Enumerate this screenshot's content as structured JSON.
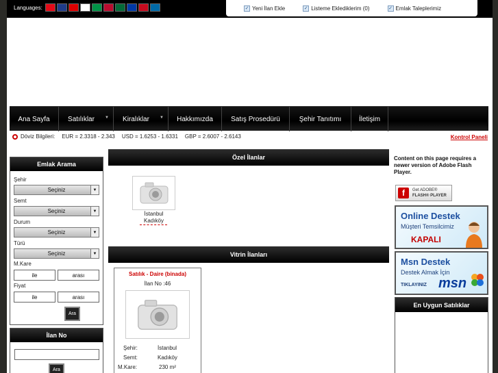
{
  "languages_label": "Languages:",
  "flags": [
    {
      "name": "turkish-flag-icon",
      "color": "#e30a17"
    },
    {
      "name": "english-flag-icon",
      "color": "#1f3c8a"
    },
    {
      "name": "german-flag-icon",
      "color": "#dd0000"
    },
    {
      "name": "french-flag-icon",
      "color": "#ffffff"
    },
    {
      "name": "italian-flag-icon",
      "color": "#009246"
    },
    {
      "name": "norwegian-flag-icon",
      "color": "#ba0c2f"
    },
    {
      "name": "portuguese-flag-icon",
      "color": "#046a38"
    },
    {
      "name": "russian-flag-icon",
      "color": "#0039a6"
    },
    {
      "name": "spanish-flag-icon",
      "color": "#c60b1e"
    },
    {
      "name": "swedish-flag-icon",
      "color": "#006aa7"
    }
  ],
  "top_links": {
    "new_listing": "Yeni İlan Ekle",
    "my_list": "Listeme Eklediklerim (0)",
    "requests": "Emlak Taleplerimiz"
  },
  "nav": [
    "Ana Sayfa",
    "Satılıklar",
    "Kiralıklar",
    "Hakkımızda",
    "Satış Prosedürü",
    "Şehir Tanıtımı",
    "İletişim"
  ],
  "rates": {
    "label": "Döviz Bilgileri:",
    "eur": "EUR = 2.3318 - 2.343",
    "usd": "USD = 1.6253 - 1.6331",
    "gbp": "GBP = 2.6007 - 2.6143"
  },
  "kontrol_paneli": "Kontrol Paneli",
  "search": {
    "title": "Emlak Arama",
    "sehir_label": "Şehir",
    "semt_label": "Semt",
    "durum_label": "Durum",
    "turu_label": "Türü",
    "select_value": "Seçiniz",
    "mkare_label": "M.Kare",
    "fiyat_label": "Fiyat",
    "ile": "ile",
    "arasi": "arası",
    "button": "Ara"
  },
  "ilan_no": {
    "title": "İlan No",
    "button": "Ara"
  },
  "ozel": {
    "title": "Özel İlanlar",
    "city": "İstanbul",
    "district": "Kadıköy"
  },
  "vitrin": {
    "title": "Vitrin İlanları",
    "heading": "Satılık - Daire (binada)",
    "ilan_no": "İlan No :46",
    "sehir_label": "Şehir:",
    "sehir_value": "İstanbul",
    "semt_label": "Semt:",
    "semt_value": "Kadıköy",
    "mkare_label": "M.Kare:",
    "mkare_value": "230 m²"
  },
  "flash": {
    "message": "Content on this page requires a newer version of Adobe Flash Player.",
    "badge_line1": "Get ADOBE®",
    "badge_line2": "FLASH® PLAYER"
  },
  "online_destek": {
    "title": "Online Destek",
    "line": "Müşteri Temsilcimiz",
    "status": "KAPALI"
  },
  "msn_destek": {
    "title": "Msn Destek",
    "line": "Destek Almak İçin",
    "tiklayiniz": "TIKLAYINIZ",
    "logo": "msn"
  },
  "en_uygun": {
    "title": "En Uygun Satılıklar"
  }
}
